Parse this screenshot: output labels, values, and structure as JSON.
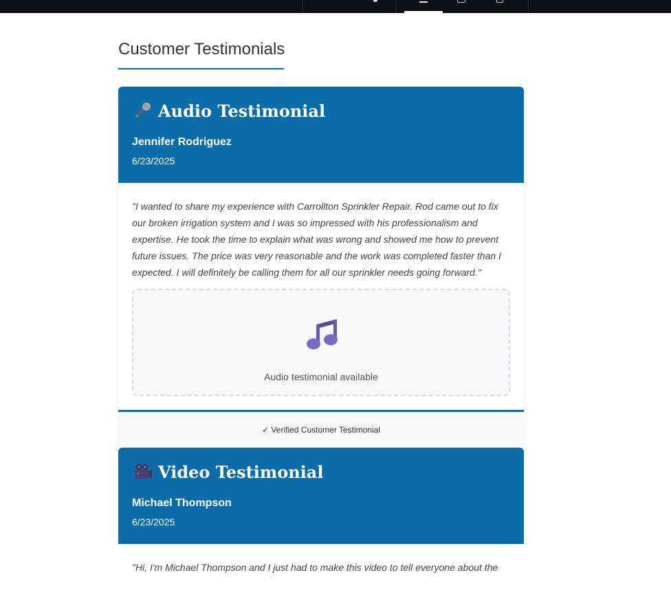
{
  "section": {
    "title": "Customer Testimonials"
  },
  "testimonials": [
    {
      "type_label": "Audio Testimonial",
      "icon": "microphone-icon",
      "name": "Jennifer Rodriguez",
      "date": "6/23/2025",
      "quote": "\"I wanted to share my experience with Carrollton Sprinkler Repair. Rod came out to fix our broken irrigation system and I was so impressed with his professionalism and expertise. He took the time to explain what was wrong and showed me how to prevent future issues. The price was very reasonable and the work was completed faster than I expected. I will definitely be calling them for all our sprinkler needs going forward.\"",
      "media_icon": "music-note-icon",
      "media_label": "Audio testimonial available",
      "verified": "✓ Verified Customer Testimonial"
    },
    {
      "type_label": "Video Testimonial",
      "icon": "video-camera-icon",
      "name": "Michael Thompson",
      "date": "6/23/2025",
      "quote": "\"Hi, I'm Michael Thompson and I just had to make this video to tell everyone about the"
    }
  ],
  "colors": {
    "accent": "#0a6ca8",
    "topbar": "#0d1117",
    "media_bg": "#f7f8fa"
  }
}
